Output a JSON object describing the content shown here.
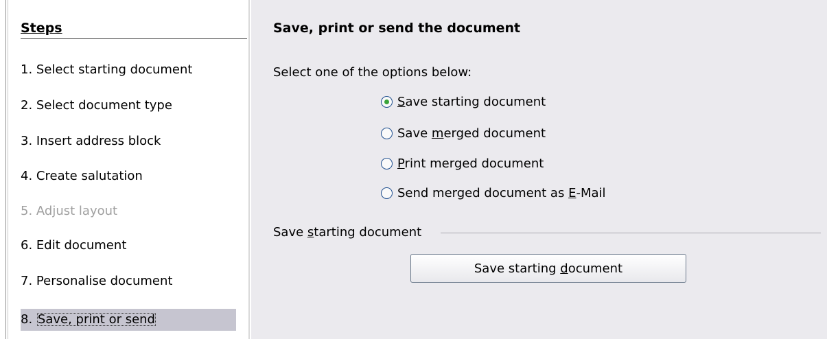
{
  "sidebar": {
    "title": "Steps",
    "steps": [
      {
        "number": "1.",
        "label": "Select starting document",
        "state": "normal"
      },
      {
        "number": "2.",
        "label": "Select document type",
        "state": "normal"
      },
      {
        "number": "3.",
        "label": "Insert address block",
        "state": "normal"
      },
      {
        "number": "4.",
        "label": "Create salutation",
        "state": "normal"
      },
      {
        "number": "5.",
        "label": "Adjust layout",
        "state": "disabled"
      },
      {
        "number": "6.",
        "label": "Edit document",
        "state": "normal"
      },
      {
        "number": "7.",
        "label": "Personalise document",
        "state": "normal"
      },
      {
        "number": "8.",
        "label": "Save, print or send",
        "state": "current"
      }
    ]
  },
  "main": {
    "heading": "Save, print or send the document",
    "intro": "Select one of the options below:",
    "options": [
      {
        "before": "",
        "mnemonic": "S",
        "after": "ave starting document",
        "checked": true
      },
      {
        "before": "Save ",
        "mnemonic": "m",
        "after": "erged document",
        "checked": false
      },
      {
        "before": "",
        "mnemonic": "P",
        "after": "rint merged document",
        "checked": false
      },
      {
        "before": "Send merged document as ",
        "mnemonic": "E",
        "after": "-Mail",
        "checked": false
      }
    ],
    "group_label": {
      "before": "Save ",
      "mnemonic": "s",
      "after": "tarting document"
    },
    "button": {
      "before": "Save starting ",
      "mnemonic": "d",
      "after": "ocument"
    }
  },
  "colors": {
    "panel_bg": "#ebeaee",
    "current_step_bg": "#c6c5d0",
    "disabled_text": "#a0a0a0",
    "radio_checked": "#3aa43a"
  }
}
